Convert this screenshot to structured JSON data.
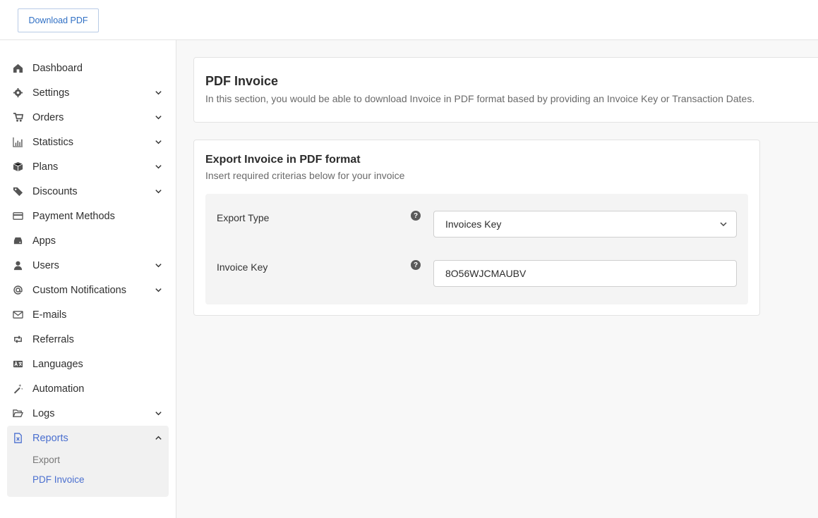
{
  "topbar": {
    "download_label": "Download PDF"
  },
  "sidebar": {
    "items": [
      {
        "label": "Dashboard",
        "icon": "home-icon",
        "chevron": false
      },
      {
        "label": "Settings",
        "icon": "gear-icon",
        "chevron": true
      },
      {
        "label": "Orders",
        "icon": "cart-icon",
        "chevron": true
      },
      {
        "label": "Statistics",
        "icon": "bar-chart-icon",
        "chevron": true
      },
      {
        "label": "Plans",
        "icon": "box-icon",
        "chevron": true
      },
      {
        "label": "Discounts",
        "icon": "tags-icon",
        "chevron": true
      },
      {
        "label": "Payment Methods",
        "icon": "credit-card-icon",
        "chevron": false
      },
      {
        "label": "Apps",
        "icon": "hdd-icon",
        "chevron": false
      },
      {
        "label": "Users",
        "icon": "user-icon",
        "chevron": true
      },
      {
        "label": "Custom Notifications",
        "icon": "at-icon",
        "chevron": true
      },
      {
        "label": "E-mails",
        "icon": "envelope-icon",
        "chevron": false
      },
      {
        "label": "Referrals",
        "icon": "retweet-icon",
        "chevron": false
      },
      {
        "label": "Languages",
        "icon": "language-icon",
        "chevron": false
      },
      {
        "label": "Automation",
        "icon": "magic-wand-icon",
        "chevron": false
      },
      {
        "label": "Logs",
        "icon": "folder-open-icon",
        "chevron": true
      }
    ],
    "reports": {
      "label": "Reports",
      "icon": "file-excel-icon",
      "sub_items": [
        {
          "label": "Export",
          "active": false
        },
        {
          "label": "PDF Invoice",
          "active": true
        }
      ]
    }
  },
  "header_card": {
    "title": "PDF Invoice",
    "description": "In this section, you would be able to download Invoice in PDF format based by providing an Invoice Key or Transaction Dates."
  },
  "export_card": {
    "title": "Export Invoice in PDF format",
    "subtitle": "Insert required criterias below for your invoice",
    "export_type_label": "Export Type",
    "export_type_value": "Invoices Key",
    "invoice_key_label": "Invoice Key",
    "invoice_key_value": "8O56WJCMAUBV"
  },
  "colors": {
    "accent": "#4a6fcf",
    "button_text": "#2f6fc4"
  }
}
